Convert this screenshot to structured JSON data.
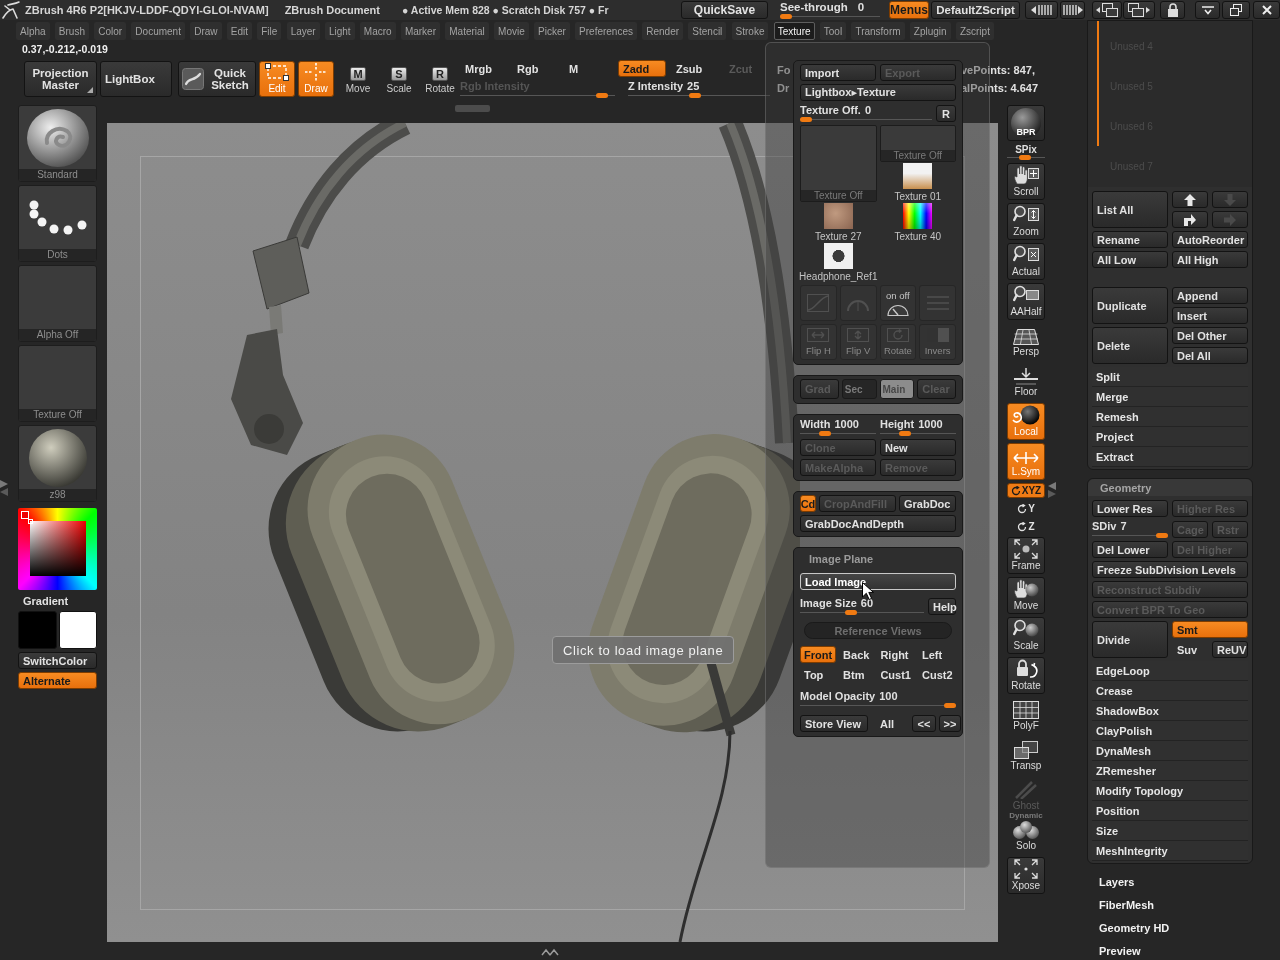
{
  "title_bar": {
    "title": "ZBrush 4R6 P2[HKJV-LDDF-QDYI-GLOI-NVAM]",
    "document": "ZBrush Document",
    "status": "● Active Mem 828 ● Scratch Disk 757 ● Fr",
    "quicksave": {
      "label": "QuickSave"
    },
    "see_through": {
      "label": "See-through",
      "value": "0",
      "level": 0
    },
    "menus": {
      "label": "Menus",
      "on": true
    },
    "script": {
      "label": "DefaultZScript"
    }
  },
  "menu_bar": [
    {
      "label": "Alpha",
      "selected": false
    },
    {
      "label": "Brush",
      "selected": false
    },
    {
      "label": "Color",
      "selected": false
    },
    {
      "label": "Document",
      "selected": false
    },
    {
      "label": "Draw",
      "selected": false
    },
    {
      "label": "Edit",
      "selected": false
    },
    {
      "label": "File",
      "selected": false
    },
    {
      "label": "Layer",
      "selected": false
    },
    {
      "label": "Light",
      "selected": false
    },
    {
      "label": "Macro",
      "selected": false
    },
    {
      "label": "Marker",
      "selected": false
    },
    {
      "label": "Material",
      "selected": false
    },
    {
      "label": "Movie",
      "selected": false
    },
    {
      "label": "Picker",
      "selected": false
    },
    {
      "label": "Preferences",
      "selected": false
    },
    {
      "label": "Render",
      "selected": false
    },
    {
      "label": "Stencil",
      "selected": false
    },
    {
      "label": "Stroke",
      "selected": false
    },
    {
      "label": "Texture",
      "selected": true
    },
    {
      "label": "Tool",
      "selected": false
    },
    {
      "label": "Transform",
      "selected": false
    },
    {
      "label": "Zplugin",
      "selected": false
    },
    {
      "label": "Zscript",
      "selected": false
    }
  ],
  "coordinates": "0.37,-0.212,-0.019",
  "top_shelf": {
    "buttons": [
      {
        "label": "Projection Master"
      },
      {
        "label": "LightBox"
      },
      {
        "label": "Quick Sketch"
      }
    ],
    "tools": [
      {
        "label": "Edit",
        "on": true
      },
      {
        "label": "Draw",
        "on": true
      },
      {
        "label": "Move",
        "key": "M",
        "on": false
      },
      {
        "label": "Scale",
        "key": "S",
        "on": false
      },
      {
        "label": "Rotate",
        "key": "R",
        "on": false
      }
    ],
    "channels": [
      {
        "label": "Mrgb",
        "on": false
      },
      {
        "label": "Rgb",
        "on": false
      },
      {
        "label": "M",
        "on": false
      }
    ],
    "rgb_intensity": {
      "label": "Rgb Intensity",
      "disabled": true,
      "level": 0.95
    },
    "z_modes": [
      {
        "label": "Zadd",
        "on": true,
        "disabled": false
      },
      {
        "label": "Zsub",
        "on": false,
        "disabled": false
      },
      {
        "label": "Zcut",
        "on": false,
        "disabled": true
      }
    ],
    "z_intensity": {
      "label": "Z Intensity",
      "value": "25",
      "level": 0.47
    },
    "cut_labels": [
      "Fo",
      "Dr"
    ],
    "stats": [
      "vePoints: 847,",
      "alPoints: 4.647"
    ]
  },
  "left_shelf": {
    "tiles": [
      {
        "kind": "brush",
        "label": "Standard"
      },
      {
        "kind": "stroke",
        "label": "Dots"
      },
      {
        "kind": "empty",
        "label": "Alpha Off"
      },
      {
        "kind": "empty",
        "label": "Texture Off"
      },
      {
        "kind": "material",
        "label": "z98"
      }
    ],
    "gradient": {
      "label": "Gradient"
    },
    "swatches": [
      {
        "color": "#000000"
      },
      {
        "color": "#ffffff"
      }
    ],
    "switch_color": {
      "label": "SwitchColor"
    },
    "alternate": {
      "label": "Alternate",
      "on": true
    }
  },
  "canvas": {
    "tooltip": "Click to load image plane"
  },
  "texture_palette": {
    "import": {
      "label": "Import",
      "disabled": false
    },
    "export": {
      "label": "Export",
      "disabled": true
    },
    "lightbox": {
      "label": "Lightbox▸Texture"
    },
    "current": {
      "label": "Texture Off.",
      "value": "0",
      "level": 0
    },
    "reset": {
      "label": "R"
    },
    "thumbnails": [
      {
        "kind": "blank",
        "label": "Texture Off"
      },
      {
        "kind": "blank",
        "label": "Texture Off"
      },
      {
        "kind": "photo",
        "label": "Texture 01"
      },
      {
        "kind": "photo",
        "label": "Texture 27"
      },
      {
        "kind": "spectrum",
        "label": "Texture 40"
      },
      {
        "kind": "photo",
        "label": "Headphone_Ref1"
      }
    ],
    "tools": [
      {
        "disabled": true
      },
      {
        "disabled": true
      },
      {
        "label": "on off",
        "disabled": false
      },
      {
        "disabled": true
      },
      {
        "label": "Flip H",
        "disabled": true
      },
      {
        "label": "Flip V",
        "disabled": true
      },
      {
        "label": "Rotate",
        "disabled": true
      },
      {
        "label": "Invers",
        "disabled": true
      }
    ],
    "colors": [
      {
        "kind": "button",
        "label": "Grad",
        "disabled": true
      },
      {
        "kind": "swatch",
        "label": "Sec",
        "color": "#262626",
        "disabled": true
      },
      {
        "kind": "swatch",
        "label": "Main",
        "color": "#8c8c8c",
        "disabled": true
      },
      {
        "kind": "button",
        "label": "Clear",
        "disabled": true
      }
    ],
    "size": [
      {
        "label": "Width",
        "value": "1000",
        "level": 0.3
      },
      {
        "label": "Height",
        "value": "1000",
        "level": 0.3
      }
    ],
    "actions": [
      {
        "label": "Clone",
        "disabled": true
      },
      {
        "label": "New",
        "disabled": false
      },
      {
        "label": "MakeAlpha",
        "disabled": true
      },
      {
        "label": "Remove",
        "disabled": true
      }
    ],
    "grab": [
      {
        "label": "Cd",
        "on": true,
        "disabled": false
      },
      {
        "label": "CropAndFill",
        "on": false,
        "disabled": true
      },
      {
        "label": "GrabDoc",
        "on": false,
        "disabled": false
      },
      {
        "label": "GrabDocAndDepth",
        "on": false,
        "disabled": false
      }
    ],
    "image_plane": {
      "title": "Image Plane",
      "load": {
        "label": "Load Image",
        "hovered": true
      },
      "image_size": {
        "label": "Image Size",
        "value": "60",
        "level": 0.4
      },
      "help": {
        "label": "Help"
      },
      "reference_title": {
        "label": "Reference Views"
      },
      "views": [
        {
          "label": "Front",
          "selected": true
        },
        {
          "label": "Back",
          "selected": false
        },
        {
          "label": "Right",
          "selected": false
        },
        {
          "label": "Left",
          "selected": false
        },
        {
          "label": "Top",
          "selected": false
        },
        {
          "label": "Btm",
          "selected": false
        },
        {
          "label": "Cust1",
          "selected": false
        },
        {
          "label": "Cust2",
          "selected": false
        }
      ],
      "model_opacity": {
        "label": "Model Opacity",
        "value": "100",
        "level": 1
      },
      "store": [
        {
          "kind": "button",
          "label": "Store View"
        },
        {
          "kind": "toggle",
          "label": "All"
        },
        {
          "kind": "button",
          "label": "<<"
        },
        {
          "kind": "button",
          "label": ">>"
        }
      ]
    }
  },
  "right_toolbar": [
    {
      "kind": "render",
      "label": "BPR",
      "on": false,
      "disabled": false
    },
    {
      "kind": "slider",
      "label": "SPix",
      "level": 0.45
    },
    {
      "kind": "button",
      "label": "Scroll",
      "on": false,
      "disabled": false
    },
    {
      "kind": "button",
      "label": "Zoom",
      "on": false,
      "disabled": false
    },
    {
      "kind": "button",
      "label": "Actual",
      "on": false,
      "disabled": false
    },
    {
      "kind": "button",
      "label": "AAHalf",
      "on": false,
      "disabled": false
    },
    {
      "kind": "toggle",
      "label": "Persp",
      "on": false,
      "disabled": false
    },
    {
      "kind": "toggle",
      "label": "Floor",
      "on": false,
      "disabled": false
    },
    {
      "kind": "toggle",
      "label": "Local",
      "on": true,
      "disabled": false
    },
    {
      "kind": "toggle",
      "label": "L.Sym",
      "on": true,
      "disabled": false
    },
    {
      "kind": "small",
      "label": "XYZ",
      "on": true,
      "disabled": false
    },
    {
      "kind": "small",
      "label": "Y",
      "on": false,
      "disabled": false
    },
    {
      "kind": "small",
      "label": "Z",
      "on": false,
      "disabled": false
    },
    {
      "kind": "button",
      "label": "Frame",
      "on": false,
      "disabled": false
    },
    {
      "kind": "button",
      "label": "Move",
      "on": false,
      "disabled": false
    },
    {
      "kind": "button",
      "label": "Scale",
      "on": false,
      "disabled": false
    },
    {
      "kind": "button",
      "label": "Rotate",
      "on": false,
      "disabled": false
    },
    {
      "kind": "toggle",
      "label": "PolyF",
      "on": false,
      "disabled": false
    },
    {
      "kind": "toggle",
      "label": "Transp",
      "on": false,
      "disabled": false
    },
    {
      "kind": "toggle",
      "label": "Ghost",
      "on": false,
      "disabled": true
    },
    {
      "kind": "toggle",
      "label": "Solo",
      "caption": "Dynamic",
      "on": false,
      "disabled": false
    },
    {
      "kind": "button",
      "label": "Xpose",
      "on": false,
      "disabled": false
    }
  ],
  "subtool_panel": {
    "items": [
      {
        "label": "Unused 4"
      },
      {
        "label": "Unused 5"
      },
      {
        "label": "Unused 6"
      },
      {
        "label": "Unused 7"
      }
    ],
    "groups": [
      [
        {
          "kind": "pair",
          "main": {
            "label": "List All"
          },
          "side": [
            [
              {
                "kind": "icon",
                "disabled": false
              },
              {
                "kind": "icon",
                "disabled": true
              }
            ],
            [
              {
                "kind": "icon",
                "disabled": false
              },
              {
                "kind": "icon",
                "disabled": true
              }
            ]
          ]
        },
        {
          "kind": "split",
          "cells": [
            {
              "label": "Rename"
            },
            {
              "label": "AutoReorder"
            }
          ]
        },
        {
          "kind": "split",
          "cells": [
            {
              "label": "All Low"
            },
            {
              "label": "All High"
            }
          ]
        }
      ],
      [
        {
          "kind": "pair",
          "main": {
            "label": "Duplicate"
          },
          "side": [
            [
              {
                "label": "Append"
              }
            ],
            [
              {
                "label": "Insert"
              }
            ]
          ]
        },
        {
          "kind": "pair",
          "main": {
            "label": "Delete"
          },
          "side": [
            [
              {
                "label": "Del Other"
              }
            ],
            [
              {
                "label": "Del All"
              }
            ]
          ]
        }
      ],
      [
        {
          "kind": "item",
          "label": "Split"
        },
        {
          "kind": "item",
          "label": "Merge"
        },
        {
          "kind": "item",
          "label": "Remesh"
        },
        {
          "kind": "item",
          "label": "Project"
        },
        {
          "kind": "item",
          "label": "Extract"
        }
      ]
    ]
  },
  "geometry_panel": {
    "title": "Geometry",
    "rows": [
      {
        "kind": "split",
        "cells": [
          {
            "label": "Lower Res",
            "disabled": false
          },
          {
            "label": "Higher Res",
            "disabled": true
          }
        ]
      },
      {
        "kind": "slider_split",
        "slider": {
          "label": "SDiv",
          "value": "7",
          "level": 1
        },
        "cells": [
          {
            "label": "Cage",
            "disabled": true
          },
          {
            "label": "Rstr",
            "disabled": true
          }
        ]
      },
      {
        "kind": "split",
        "cells": [
          {
            "label": "Del Lower",
            "disabled": false
          },
          {
            "label": "Del Higher",
            "disabled": true
          }
        ]
      },
      {
        "kind": "wide",
        "cell": {
          "label": "Freeze SubDivision Levels",
          "disabled": false
        }
      },
      {
        "kind": "wide",
        "cell": {
          "label": "Reconstruct Subdiv",
          "disabled": true
        }
      },
      {
        "kind": "wide",
        "cell": {
          "label": "Convert BPR To Geo",
          "disabled": true
        }
      },
      {
        "kind": "pair",
        "main": {
          "label": "Divide"
        },
        "side": [
          [
            {
              "kind": "button",
              "label": "Smt",
              "on": true
            }
          ],
          [
            {
              "kind": "toggle",
              "label": "Suv",
              "on": false
            },
            {
              "kind": "button",
              "label": "ReUV",
              "on": false
            }
          ]
        ]
      },
      {
        "kind": "item",
        "label": "EdgeLoop"
      },
      {
        "kind": "item",
        "label": "Crease"
      },
      {
        "kind": "item",
        "label": "ShadowBox"
      },
      {
        "kind": "item",
        "label": "ClayPolish"
      },
      {
        "kind": "item",
        "label": "DynaMesh"
      },
      {
        "kind": "item",
        "label": "ZRemesher"
      },
      {
        "kind": "item",
        "label": "Modify Topology"
      },
      {
        "kind": "item",
        "label": "Position"
      },
      {
        "kind": "item",
        "label": "Size"
      },
      {
        "kind": "item",
        "label": "MeshIntegrity"
      }
    ]
  },
  "palette_headers": [
    {
      "label": "Layers"
    },
    {
      "label": "FiberMesh"
    },
    {
      "label": "Geometry HD"
    },
    {
      "label": "Preview"
    }
  ]
}
